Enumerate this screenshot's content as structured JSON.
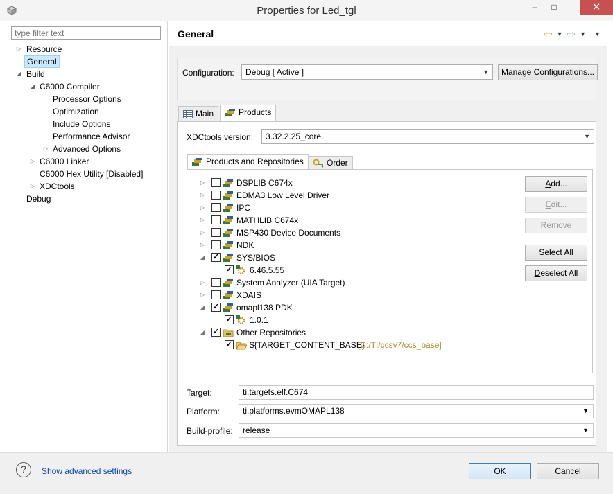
{
  "window": {
    "title": "Properties for Led_tgl",
    "app_icon": "cube-icon",
    "minimize_glyph": "–",
    "maximize_glyph": "□",
    "close_glyph": "✕"
  },
  "sidebar": {
    "filter_placeholder": "type filter text",
    "items": [
      {
        "label": "Resource",
        "arrow": "▷"
      },
      {
        "label": "General",
        "arrow": ""
      },
      {
        "label": "Build",
        "arrow": "◢"
      },
      {
        "label": "C6000 Compiler",
        "arrow": "◢"
      },
      {
        "label": "Processor Options",
        "arrow": ""
      },
      {
        "label": "Optimization",
        "arrow": ""
      },
      {
        "label": "Include Options",
        "arrow": ""
      },
      {
        "label": "Performance Advisor",
        "arrow": ""
      },
      {
        "label": "Advanced Options",
        "arrow": "▷"
      },
      {
        "label": "C6000 Linker",
        "arrow": "▷"
      },
      {
        "label": "C6000 Hex Utility  [Disabled]",
        "arrow": ""
      },
      {
        "label": "XDCtools",
        "arrow": "▷"
      },
      {
        "label": "Debug",
        "arrow": ""
      }
    ]
  },
  "page": {
    "title": "General",
    "nav_icons": [
      "back-arrow-icon",
      "dropdown-icon",
      "forward-arrow-icon",
      "dropdown-icon",
      "view-menu-icon"
    ],
    "back_glyph": "⇦",
    "forward_glyph": "⇨",
    "dd_glyph": "▼"
  },
  "configuration": {
    "label": "Configuration:",
    "value": "Debug  [ Active ]",
    "manage_button": "Manage Configurations..."
  },
  "tabs": [
    {
      "label": "Main",
      "icon": "table-icon"
    },
    {
      "label": "Products",
      "icon": "packages-icon"
    }
  ],
  "xdctools": {
    "label": "XDCtools version:",
    "value": "3.32.2.25_core"
  },
  "inner_tabs": [
    {
      "label": "Products and Repositories",
      "icon": "packages-icon"
    },
    {
      "label": "Order",
      "icon": "order-icon"
    }
  ],
  "tree": [
    {
      "label": "DSPLIB C674x",
      "checked": false,
      "expander": "▷",
      "level": 0,
      "icon": "package-icon"
    },
    {
      "label": "EDMA3 Low Level Driver",
      "checked": false,
      "expander": "▷",
      "level": 0,
      "icon": "package-icon"
    },
    {
      "label": "IPC",
      "checked": false,
      "expander": "▷",
      "level": 0,
      "icon": "package-icon"
    },
    {
      "label": "MATHLIB C674x",
      "checked": false,
      "expander": "▷",
      "level": 0,
      "icon": "package-icon"
    },
    {
      "label": "MSP430 Device Documents",
      "checked": false,
      "expander": "▷",
      "level": 0,
      "icon": "package-icon"
    },
    {
      "label": "NDK",
      "checked": false,
      "expander": "▷",
      "level": 0,
      "icon": "package-icon"
    },
    {
      "label": "SYS/BIOS",
      "checked": true,
      "expander": "◢",
      "level": 0,
      "icon": "package-icon"
    },
    {
      "label": "6.46.5.55",
      "checked": true,
      "expander": "",
      "level": 1,
      "icon": "version-gear-icon"
    },
    {
      "label": "System Analyzer (UIA Target)",
      "checked": false,
      "expander": "▷",
      "level": 0,
      "icon": "package-icon"
    },
    {
      "label": "XDAIS",
      "checked": false,
      "expander": "▷",
      "level": 0,
      "icon": "package-icon"
    },
    {
      "label": "omapl138 PDK",
      "checked": true,
      "expander": "◢",
      "level": 0,
      "icon": "package-icon"
    },
    {
      "label": "1.0.1",
      "checked": true,
      "expander": "",
      "level": 1,
      "icon": "version-gear-icon"
    },
    {
      "label": "Other Repositories",
      "checked": true,
      "expander": "◢",
      "level": 0,
      "icon": "folder-icon"
    },
    {
      "label": "${TARGET_CONTENT_BASE}",
      "path": "[C:/TI/ccsv7/ccs_base]",
      "checked": true,
      "expander": "",
      "level": 1,
      "icon": "open-folder-icon"
    }
  ],
  "tree_buttons": {
    "add": "Add...",
    "edit": "Edit...",
    "remove": "Remove",
    "select_all": "Select All",
    "deselect_all": "Deselect All"
  },
  "target": {
    "label": "Target:",
    "value": "ti.targets.elf.C674"
  },
  "platform": {
    "label": "Platform:",
    "value": "ti.platforms.evmOMAPL138"
  },
  "build_profile": {
    "label": "Build-profile:",
    "value": "release"
  },
  "footer": {
    "help_glyph": "?",
    "advanced_link": "Show advanced settings",
    "ok": "OK",
    "cancel": "Cancel"
  }
}
